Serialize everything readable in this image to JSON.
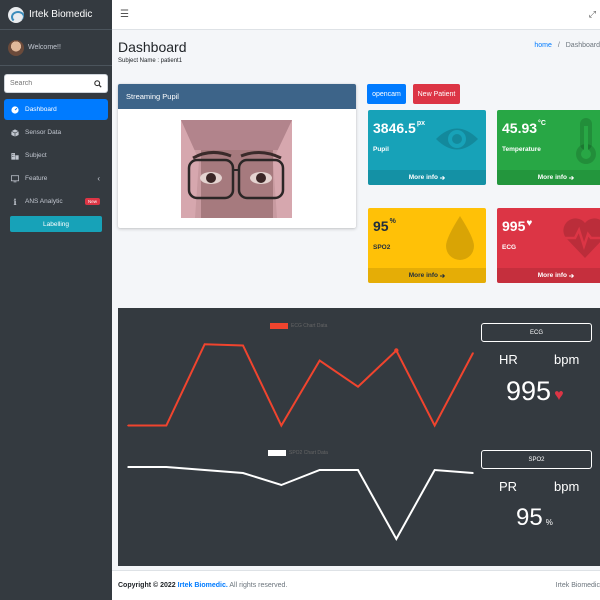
{
  "brand": {
    "name": "Irtek Biomedic"
  },
  "user": {
    "greeting": "Welcome!!"
  },
  "search": {
    "placeholder": "Search"
  },
  "sidebar": {
    "items": [
      {
        "label": "Dashboard",
        "icon": "dashboard-icon"
      },
      {
        "label": "Sensor Data",
        "icon": "cube-icon"
      },
      {
        "label": "Subject",
        "icon": "building-icon"
      },
      {
        "label": "Feature",
        "icon": "monitor-icon"
      },
      {
        "label": "ANS Analytic",
        "icon": "info-icon",
        "badge": "New"
      }
    ],
    "labelling": "Labelling"
  },
  "header": {
    "title": "Dashboard",
    "subject": "Subject Name : patient1",
    "breadcrumb_home": "home",
    "breadcrumb_sep": "/",
    "breadcrumb_current": "Dashboard"
  },
  "stream": {
    "title": "Streaming Pupil"
  },
  "buttons": {
    "opencam": "opencam",
    "new_patient": "New Patient"
  },
  "boxes": {
    "pupil": {
      "value": "3846.5",
      "unit": "px",
      "label": "Pupil",
      "more": "More info"
    },
    "temperature": {
      "value": "45.93",
      "unit": "°C",
      "label": "Temperature",
      "more": "More info"
    },
    "spo2": {
      "value": "95",
      "unit": "%",
      "label": "SPO2",
      "more": "More info"
    },
    "ecg": {
      "value": "995",
      "label": "ECG",
      "more": "More info"
    }
  },
  "panel": {
    "ecg_box": "ECG",
    "hr_label": "HR",
    "hr_unit": "bpm",
    "hr_value": "995",
    "spo2_box": "SPO2",
    "pr_label": "PR",
    "pr_unit": "bpm",
    "pr_value": "95",
    "pr_value_unit": "%"
  },
  "chart_data": [
    {
      "type": "line",
      "series": [
        {
          "name": "ECG Chart Data",
          "color": "#f0442e",
          "values": [
            10,
            10,
            75,
            74,
            10,
            62,
            41,
            70,
            10,
            68
          ]
        }
      ],
      "x": [
        0,
        1,
        2,
        3,
        4,
        5,
        6,
        7,
        8,
        9
      ],
      "ylim": [
        0,
        80
      ],
      "grid": false,
      "legend": "top-center"
    },
    {
      "type": "line",
      "series": [
        {
          "name": "SPO2 Chart Data",
          "color": "#ffffff",
          "values": [
            97,
            97,
            96,
            95,
            91,
            96,
            96,
            73,
            96,
            95
          ]
        }
      ],
      "x": [
        0,
        1,
        2,
        3,
        4,
        5,
        6,
        7,
        8,
        9
      ],
      "ylim": [
        70,
        100
      ],
      "grid": false,
      "legend": "top-center"
    }
  ],
  "footer": {
    "copyright_prefix": "Copyright © 2022",
    "company": "Irtek Biomedic.",
    "rights": "All rights reserved.",
    "right_text": "Irtek Biomedic"
  }
}
